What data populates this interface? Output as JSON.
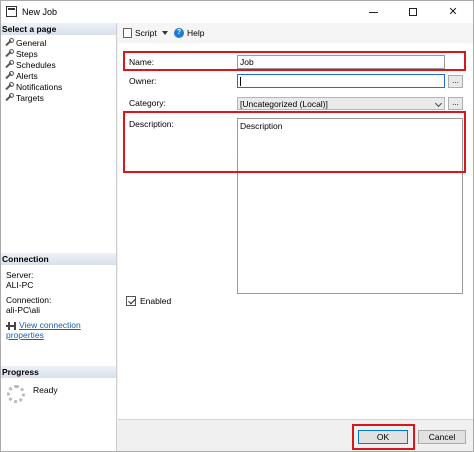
{
  "window": {
    "title": "New Job",
    "minimize_icon": "minimize-icon",
    "maximize_icon": "maximize-icon",
    "close_icon": "close-icon",
    "close_glyph": "✕"
  },
  "left_panel": {
    "select_page_header": "Select a page",
    "pages": [
      {
        "label": "General",
        "icon": "wrench-icon"
      },
      {
        "label": "Steps",
        "icon": "wrench-icon"
      },
      {
        "label": "Schedules",
        "icon": "wrench-icon"
      },
      {
        "label": "Alerts",
        "icon": "wrench-icon"
      },
      {
        "label": "Notifications",
        "icon": "wrench-icon"
      },
      {
        "label": "Targets",
        "icon": "wrench-icon"
      }
    ],
    "connection": {
      "header": "Connection",
      "server_label": "Server:",
      "server_value": "ALI-PC",
      "connection_label": "Connection:",
      "connection_value": "ali-PC\\ali",
      "view_link": "View connection properties"
    },
    "progress": {
      "header": "Progress",
      "status": "Ready"
    }
  },
  "toolbar": {
    "script_label": "Script",
    "help_label": "Help",
    "help_glyph": "?"
  },
  "form": {
    "name_label": "Name:",
    "name_value": "Job",
    "owner_label": "Owner:",
    "owner_value": "",
    "category_label": "Category:",
    "category_value": "[Uncategorized (Local)]",
    "description_label": "Description:",
    "description_value": "Description",
    "enabled_label": "Enabled",
    "ellipsis": "..."
  },
  "buttons": {
    "ok": "OK",
    "cancel": "Cancel"
  },
  "colors": {
    "highlight": "#d9161c",
    "link": "#1a5fb4",
    "focus": "#1d6fd1"
  }
}
